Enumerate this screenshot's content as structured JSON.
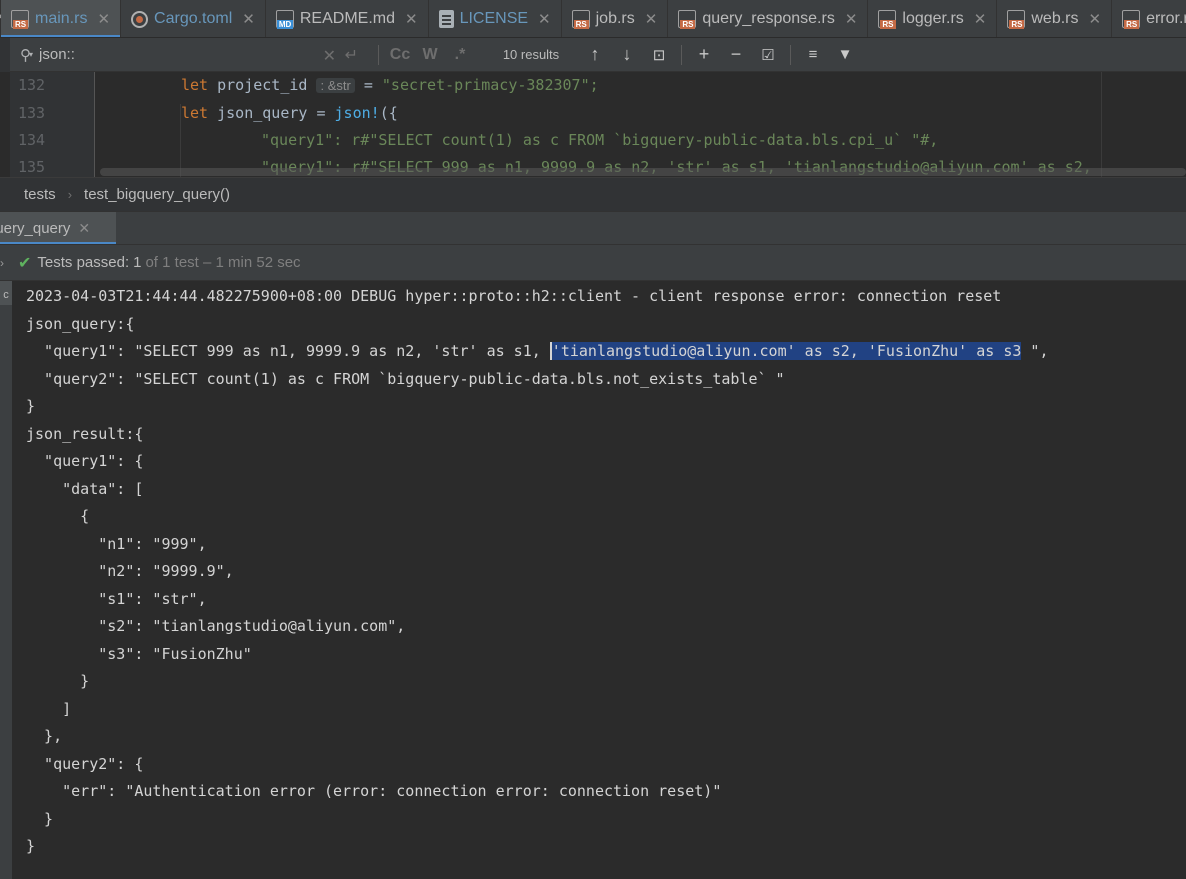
{
  "tabs": [
    {
      "icon": "rs",
      "label": "main.rs",
      "active": true
    },
    {
      "icon": "cargo",
      "label": "Cargo.toml"
    },
    {
      "icon": "md",
      "label": "README.md"
    },
    {
      "icon": "doc",
      "label": "LICENSE"
    },
    {
      "icon": "rs",
      "label": "job.rs"
    },
    {
      "icon": "rs",
      "label": "query_response.rs"
    },
    {
      "icon": "rs",
      "label": "logger.rs"
    },
    {
      "icon": "rs",
      "label": "web.rs"
    },
    {
      "icon": "rs",
      "label": "error.rs"
    }
  ],
  "search": {
    "query": "json::",
    "case_label": "Cc",
    "word_label": "W",
    "regex_label": ".*",
    "results": "10 results"
  },
  "editor": {
    "line_numbers": [
      "132",
      "133",
      "134",
      "135"
    ],
    "line132": {
      "kw": "let",
      "ident": "project_id",
      "hint": ": &str",
      "eq": "=",
      "value": "\"secret-primacy-382307\";"
    },
    "line133": {
      "kw": "let",
      "ident": "json_query",
      "eq": "=",
      "macro": "json!",
      "rest": "({"
    },
    "line134": {
      "text": "\"query1\": r#\"SELECT count(1) as c FROM `bigquery-public-data.bls.cpi_u` \"#,"
    },
    "line135": {
      "text": "\"query1\": r#\"SELECT 999 as n1, 9999.9 as n2, 'str' as s1, 'tianlangstudio@aliyun.com' as s2,"
    }
  },
  "breadcrumbs": [
    "tests",
    "test_bigquery_query()"
  ],
  "run_tab": {
    "label": "query_query"
  },
  "status": {
    "passed": "Tests passed:",
    "count": "1",
    "rest": "of 1 test – 1 min 52 sec"
  },
  "console": {
    "side_label": "c",
    "lines": [
      "2023-04-03T21:44:44.482275900+08:00 DEBUG hyper::proto::h2::client - client response error: connection reset",
      "json_query:{",
      "",
      "  \"query2\": \"SELECT count(1) as c FROM `bigquery-public-data.bls.not_exists_table` \"",
      "}",
      "json_result:{",
      "  \"query1\": {",
      "    \"data\": [",
      "      {",
      "        \"n1\": \"999\",",
      "        \"n2\": \"9999.9\",",
      "        \"s1\": \"str\",",
      "        \"s2\": \"tianlangstudio@aliyun.com\",",
      "        \"s3\": \"FusionZhu\"",
      "      }",
      "    ]",
      "  },",
      "  \"query2\": {",
      "    \"err\": \"Authentication error (error: connection error: connection reset)\"",
      "  }",
      "}"
    ],
    "query1_line": {
      "pre": "  \"query1\": \"SELECT 999 as n1, 9999.9 as n2, 'str' as s1, ",
      "selected": "'tianlangstudio@aliyun.com' as s2, 'FusionZhu' as s3",
      "post": " \","
    }
  }
}
